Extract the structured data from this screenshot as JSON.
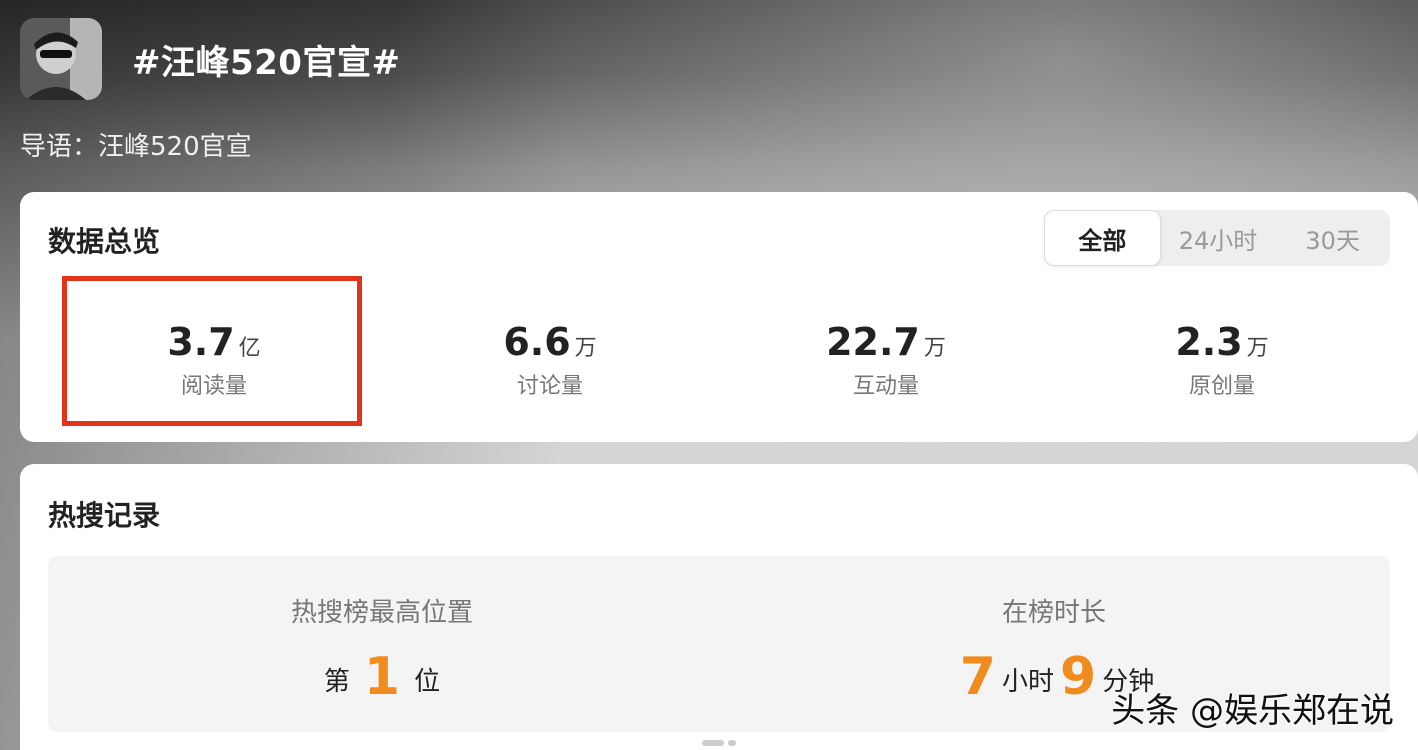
{
  "header": {
    "topic_title": "#汪峰520官宣#",
    "intro": "导语：汪峰520官宣"
  },
  "overview": {
    "title": "数据总览",
    "tabs": [
      {
        "label": "全部",
        "active": true
      },
      {
        "label": "24小时",
        "active": false
      },
      {
        "label": "30天",
        "active": false
      }
    ],
    "stats": [
      {
        "value": "3.7",
        "unit": "亿",
        "label": "阅读量",
        "highlighted": true
      },
      {
        "value": "6.6",
        "unit": "万",
        "label": "讨论量",
        "highlighted": false
      },
      {
        "value": "22.7",
        "unit": "万",
        "label": "互动量",
        "highlighted": false
      },
      {
        "value": "2.3",
        "unit": "万",
        "label": "原创量",
        "highlighted": false
      }
    ],
    "highlight_color": "#e0341c"
  },
  "hot_search": {
    "title": "热搜记录",
    "peak": {
      "label": "热搜榜最高位置",
      "prefix": "第",
      "value": "1",
      "suffix": "位"
    },
    "duration": {
      "label": "在榜时长",
      "hours": "7",
      "hours_unit": "小时",
      "minutes": "9",
      "minutes_unit": "分钟"
    },
    "accent_color": "#f08c1e"
  },
  "watermark": "头条 @娱乐郑在说"
}
